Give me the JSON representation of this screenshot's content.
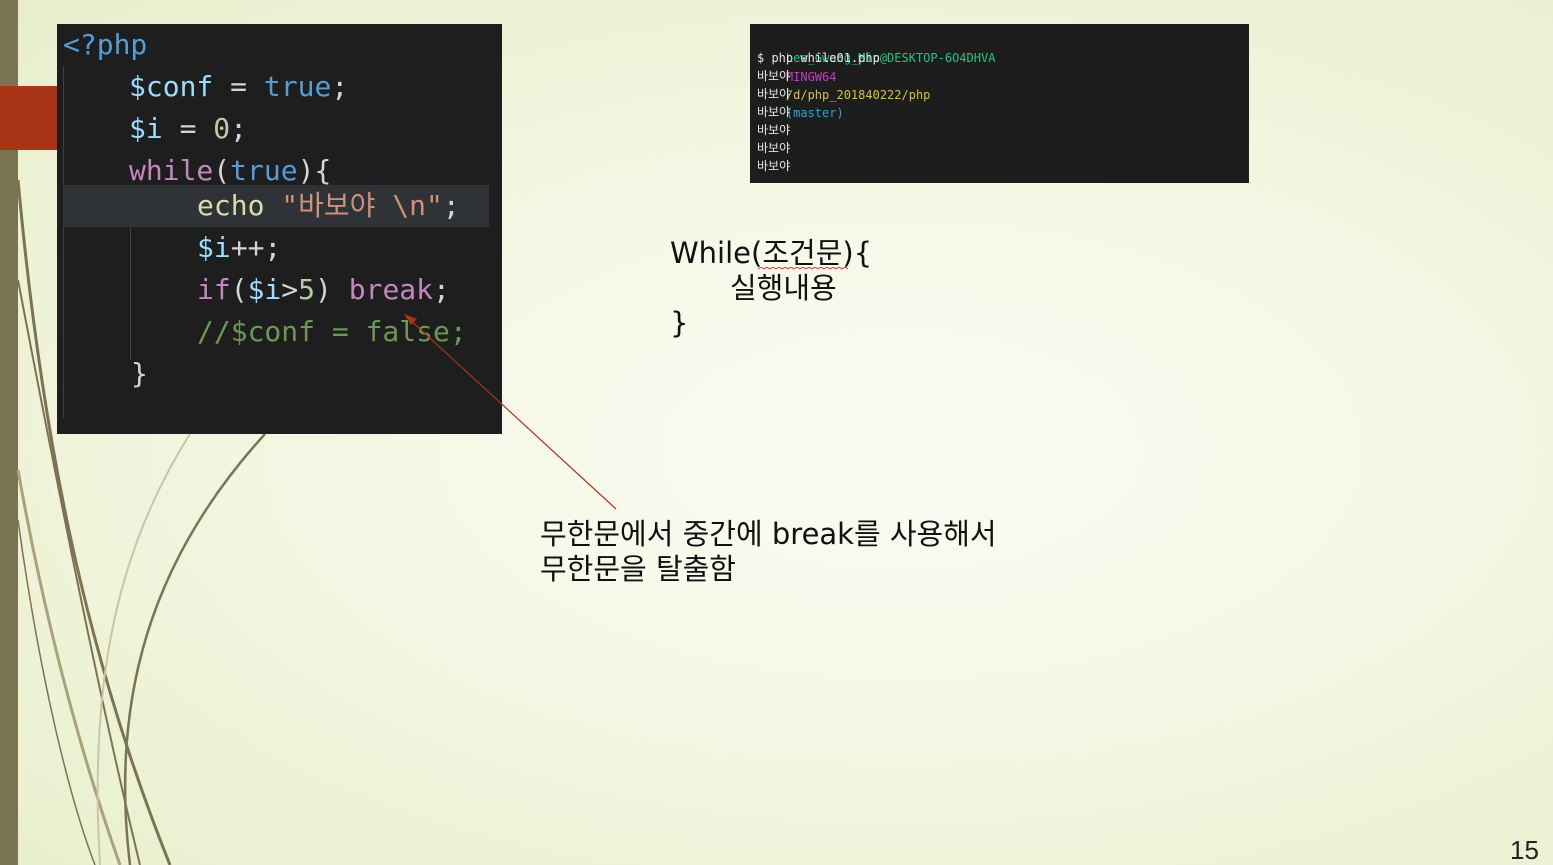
{
  "slide": {
    "page_number": "15",
    "colors": {
      "background": "#f4f7e3",
      "left_bar": "#7b7452",
      "accent_block": "#a93416",
      "swoosh": "#7b7452"
    }
  },
  "code_editor": {
    "lines": [
      {
        "tokens": [
          {
            "t": "<?php",
            "c": "tag"
          }
        ]
      },
      {
        "tokens": [
          {
            "t": "$conf",
            "c": "var"
          },
          {
            "t": " = ",
            "c": "op"
          },
          {
            "t": "true",
            "c": "kw"
          },
          {
            "t": ";",
            "c": "punc"
          }
        ]
      },
      {
        "tokens": [
          {
            "t": "$i",
            "c": "var"
          },
          {
            "t": " = ",
            "c": "op"
          },
          {
            "t": "0",
            "c": "num"
          },
          {
            "t": ";",
            "c": "punc"
          }
        ]
      },
      {
        "tokens": [
          {
            "t": "while",
            "c": "ctrl"
          },
          {
            "t": "(",
            "c": "punc"
          },
          {
            "t": "true",
            "c": "kw"
          },
          {
            "t": "){",
            "c": "punc"
          }
        ]
      },
      {
        "tokens": [
          {
            "t": "echo",
            "c": "fn"
          },
          {
            "t": " ",
            "c": "op"
          },
          {
            "t": "\"바보야 \\n\"",
            "c": "str"
          },
          {
            "t": ";",
            "c": "punc"
          }
        ]
      },
      {
        "tokens": [
          {
            "t": "$i",
            "c": "var"
          },
          {
            "t": "++;",
            "c": "op"
          }
        ]
      },
      {
        "tokens": [
          {
            "t": "if",
            "c": "ctrl"
          },
          {
            "t": "(",
            "c": "punc"
          },
          {
            "t": "$i",
            "c": "var"
          },
          {
            "t": ">",
            "c": "op"
          },
          {
            "t": "5",
            "c": "num"
          },
          {
            "t": ") ",
            "c": "punc"
          },
          {
            "t": "break",
            "c": "ctrl"
          },
          {
            "t": ";",
            "c": "punc"
          }
        ]
      },
      {
        "tokens": [
          {
            "t": "//$conf = false;",
            "c": "cmt"
          }
        ]
      },
      {
        "tokens": [
          {
            "t": "}",
            "c": "punc"
          }
        ]
      }
    ]
  },
  "terminal": {
    "prompt_user": "Lee_Gwang_Min@DESKTOP-6O4DHVA",
    "prompt_env": "MINGW64",
    "prompt_path": "/d/php_201840222/php",
    "prompt_branch": "(master)",
    "command": "$ php while01.php",
    "output": [
      "바보야",
      "바보야",
      "바보야",
      "바보야",
      "바보야",
      "바보야"
    ]
  },
  "syntax_note": {
    "line1_prefix": "While(",
    "line1_word": "조건문",
    "line1_suffix": "){",
    "line2": "실행내용",
    "line3": "}"
  },
  "annotation": {
    "line1": "무한문에서 중간에 break를 사용해서",
    "line2": "무한문을 탈출함"
  }
}
